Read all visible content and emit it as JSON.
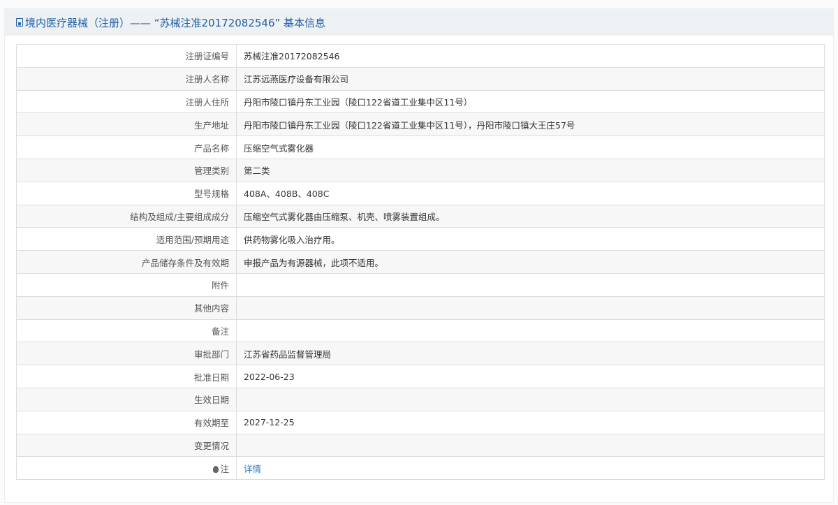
{
  "header": {
    "title": "境内医疗器械（注册）—— “苏械注准20172082546” 基本信息",
    "icon": "document-icon"
  },
  "rows": [
    {
      "label": "注册证编号",
      "value": "苏械注准20172082546"
    },
    {
      "label": "注册人名称",
      "value": "江苏远燕医疗设备有限公司"
    },
    {
      "label": "注册人住所",
      "value": "丹阳市陵口镇丹东工业园（陵口122省道工业集中区11号）"
    },
    {
      "label": "生产地址",
      "value": "丹阳市陵口镇丹东工业园（陵口122省道工业集中区11号），丹阳市陵口镇大王庄57号"
    },
    {
      "label": "产品名称",
      "value": "压缩空气式雾化器"
    },
    {
      "label": "管理类别",
      "value": "第二类"
    },
    {
      "label": "型号规格",
      "value": "408A、408B、408C"
    },
    {
      "label": "结构及组成/主要组成成分",
      "value": "压缩空气式雾化器由压缩泵、机壳、喷雾装置组成。"
    },
    {
      "label": "适用范围/预期用途",
      "value": "供药物雾化吸入治疗用。"
    },
    {
      "label": "产品储存条件及有效期",
      "value": "申报产品为有源器械，此项不适用。"
    },
    {
      "label": "附件",
      "value": ""
    },
    {
      "label": "其他内容",
      "value": ""
    },
    {
      "label": "备注",
      "value": ""
    },
    {
      "label": "审批部门",
      "value": "江苏省药品监督管理局"
    },
    {
      "label": "批准日期",
      "value": "2022-06-23"
    },
    {
      "label": "生效日期",
      "value": ""
    },
    {
      "label": "有效期至",
      "value": "2027-12-25"
    },
    {
      "label": "变更情况",
      "value": ""
    }
  ],
  "note": {
    "label": "注",
    "link": "详情",
    "icon": "lightbulb-icon"
  }
}
